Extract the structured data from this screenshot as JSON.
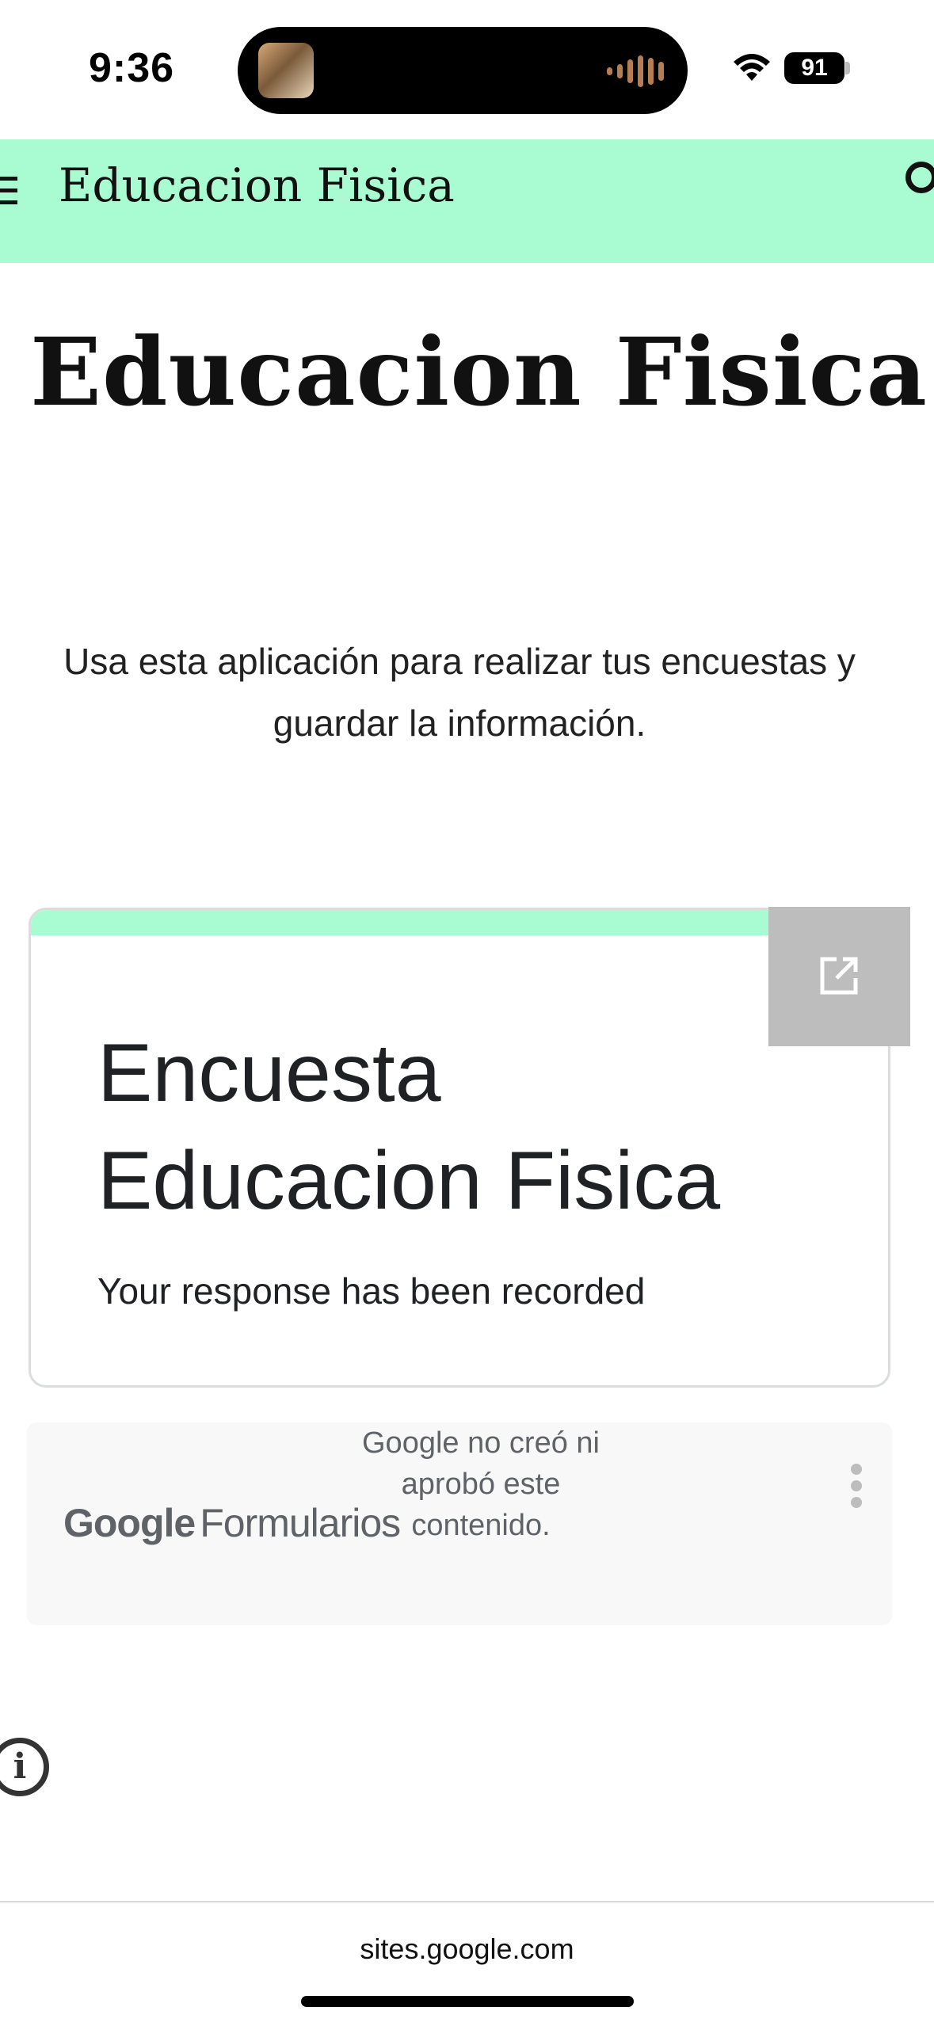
{
  "status_bar": {
    "time": "9:36",
    "battery": "91"
  },
  "header": {
    "title": "Educacion Fisica"
  },
  "page": {
    "title": "Educacion Fisica",
    "intro": "Usa esta aplicación para realizar tus encuestas y guardar la información."
  },
  "form": {
    "title": "Encuesta Educacion Fisica",
    "message": "Your response has been recorded"
  },
  "forms_footer": {
    "logo_google": "Google",
    "logo_product": "Formularios",
    "disclaimer": "Google no creó ni aprobó este contenido."
  },
  "browser": {
    "url": "sites.google.com"
  },
  "colors": {
    "accent": "#a9fcd2",
    "overlay": "#bdbdbd"
  }
}
